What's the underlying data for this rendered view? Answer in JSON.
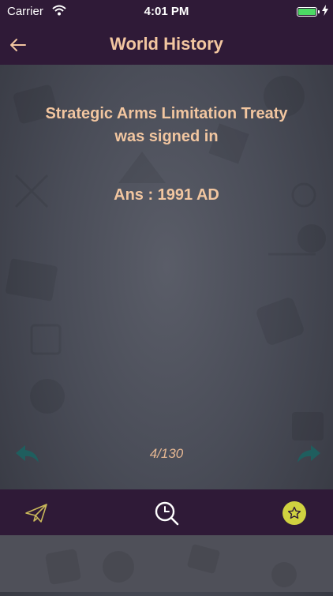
{
  "status_bar": {
    "carrier": "Carrier",
    "time": "4:01 PM",
    "battery_level": 1.0
  },
  "nav": {
    "title": "World History",
    "back_icon": "arrow-left-icon"
  },
  "card": {
    "question": "Strategic Arms Limitation Treaty was signed in",
    "answer": "Ans : 1991 AD",
    "counter": "4/130"
  },
  "tab_bar": {
    "share_icon": "paper-plane-icon",
    "search_icon": "search-icon",
    "favorite_icon": "star-icon"
  },
  "colors": {
    "bar_background": "#2f1a37",
    "text_accent": "#f2c6a0",
    "nav_arrow": "#1f5e5e",
    "favorite": "#d0d240"
  }
}
